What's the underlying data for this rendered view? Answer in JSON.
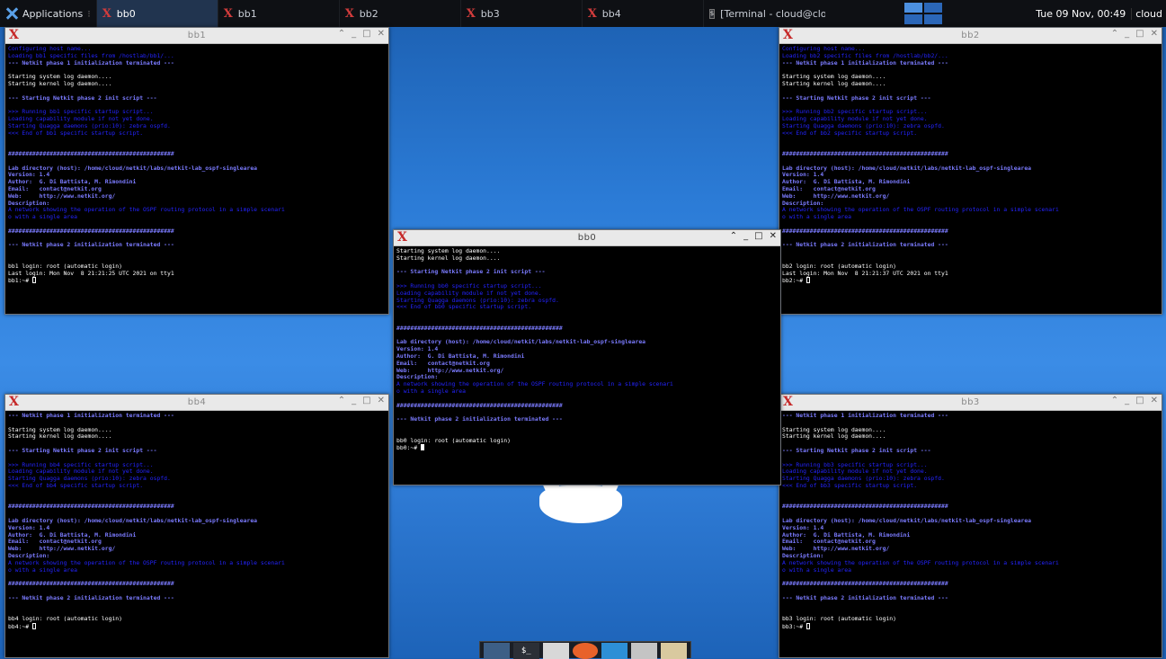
{
  "panel": {
    "apps_label": "Applications",
    "tasks": [
      {
        "label": "bb0",
        "active": true
      },
      {
        "label": "bb1"
      },
      {
        "label": "bb2"
      },
      {
        "label": "bb3"
      },
      {
        "label": "bb4"
      },
      {
        "label": "[Terminal - cloud@cloud..."
      }
    ],
    "clock": "Tue 09 Nov, 00:49",
    "user": "cloud"
  },
  "windows": {
    "bb1": {
      "title": "bb1",
      "lines": [
        {
          "t": "Configuring host name...",
          "c": "blue"
        },
        {
          "t": "Loading bb1 specific files from /hostlab/bb1/...",
          "c": "blue"
        },
        {
          "t": "--- Netkit phase 1 initialization terminated ---",
          "c": "hdr"
        },
        {
          "t": ""
        },
        {
          "t": "Starting system log daemon...."
        },
        {
          "t": "Starting kernel log daemon...."
        },
        {
          "t": ""
        },
        {
          "t": "--- Starting Netkit phase 2 init script ---",
          "c": "hdr"
        },
        {
          "t": ""
        },
        {
          "t": ">>> Running bb1 specific startup script...",
          "c": "blue"
        },
        {
          "t": "Loading capability module if not yet done.",
          "c": "blue"
        },
        {
          "t": "Starting Quagga daemons (prio:10): zebra ospfd.",
          "c": "blue"
        },
        {
          "t": "<<< End of bb1 specific startup script.",
          "c": "blue"
        },
        {
          "t": ""
        },
        {
          "t": ""
        },
        {
          "t": "################################################",
          "c": "hdr"
        },
        {
          "t": ""
        },
        {
          "t": "Lab directory (host): /home/cloud/netkit/labs/netkit-lab_ospf-singlearea",
          "c": "hdr"
        },
        {
          "t": "Version: 1.4",
          "c": "hdr"
        },
        {
          "t": "Author:  G. Di Battista, M. Rimondini",
          "c": "hdr"
        },
        {
          "t": "Email:   contact@netkit.org",
          "c": "hdr"
        },
        {
          "t": "Web:     http://www.netkit.org/",
          "c": "hdr"
        },
        {
          "t": "Description:",
          "c": "hdr"
        },
        {
          "t": "A network showing the operation of the OSPF routing protocol in a simple scenari",
          "c": "blue"
        },
        {
          "t": "o with a single area",
          "c": "blue"
        },
        {
          "t": ""
        },
        {
          "t": "################################################",
          "c": "hdr"
        },
        {
          "t": ""
        },
        {
          "t": "--- Netkit phase 2 initialization terminated ---",
          "c": "hdr"
        },
        {
          "t": ""
        },
        {
          "t": ""
        },
        {
          "t": "bb1 login: root (automatic login)"
        },
        {
          "t": "Last login: Mon Nov  8 21:21:25 UTC 2021 on tty1"
        },
        {
          "t": "bb1:~# ",
          "cursor": "hollow"
        }
      ]
    },
    "bb2": {
      "title": "bb2",
      "lines": [
        {
          "t": "Configuring host name...",
          "c": "blue"
        },
        {
          "t": "Loading bb2 specific files from /hostlab/bb2/...",
          "c": "blue"
        },
        {
          "t": "--- Netkit phase 1 initialization terminated ---",
          "c": "hdr"
        },
        {
          "t": ""
        },
        {
          "t": "Starting system log daemon...."
        },
        {
          "t": "Starting kernel log daemon...."
        },
        {
          "t": ""
        },
        {
          "t": "--- Starting Netkit phase 2 init script ---",
          "c": "hdr"
        },
        {
          "t": ""
        },
        {
          "t": ">>> Running bb2 specific startup script...",
          "c": "blue"
        },
        {
          "t": "Loading capability module if not yet done.",
          "c": "blue"
        },
        {
          "t": "Starting Quagga daemons (prio:10): zebra ospfd.",
          "c": "blue"
        },
        {
          "t": "<<< End of bb2 specific startup script.",
          "c": "blue"
        },
        {
          "t": ""
        },
        {
          "t": ""
        },
        {
          "t": "################################################",
          "c": "hdr"
        },
        {
          "t": ""
        },
        {
          "t": "Lab directory (host): /home/cloud/netkit/labs/netkit-lab_ospf-singlearea",
          "c": "hdr"
        },
        {
          "t": "Version: 1.4",
          "c": "hdr"
        },
        {
          "t": "Author:  G. Di Battista, M. Rimondini",
          "c": "hdr"
        },
        {
          "t": "Email:   contact@netkit.org",
          "c": "hdr"
        },
        {
          "t": "Web:     http://www.netkit.org/",
          "c": "hdr"
        },
        {
          "t": "Description:",
          "c": "hdr"
        },
        {
          "t": "A network showing the operation of the OSPF routing protocol in a simple scenari",
          "c": "blue"
        },
        {
          "t": "o with a single area",
          "c": "blue"
        },
        {
          "t": ""
        },
        {
          "t": "################################################",
          "c": "hdr"
        },
        {
          "t": ""
        },
        {
          "t": "--- Netkit phase 2 initialization terminated ---",
          "c": "hdr"
        },
        {
          "t": ""
        },
        {
          "t": ""
        },
        {
          "t": "bb2 login: root (automatic login)"
        },
        {
          "t": "Last login: Mon Nov  8 21:21:37 UTC 2021 on tty1"
        },
        {
          "t": "bb2:~# ",
          "cursor": "hollow"
        }
      ]
    },
    "bb0": {
      "title": "bb0",
      "lines": [
        {
          "t": "Starting system log daemon...."
        },
        {
          "t": "Starting kernel log daemon...."
        },
        {
          "t": ""
        },
        {
          "t": "--- Starting Netkit phase 2 init script ---",
          "c": "hdr"
        },
        {
          "t": ""
        },
        {
          "t": ">>> Running bb0 specific startup script...",
          "c": "blue"
        },
        {
          "t": "Loading capability module if not yet done.",
          "c": "blue"
        },
        {
          "t": "Starting Quagga daemons (prio:10): zebra ospfd.",
          "c": "blue"
        },
        {
          "t": "<<< End of bb0 specific startup script.",
          "c": "blue"
        },
        {
          "t": ""
        },
        {
          "t": ""
        },
        {
          "t": "################################################",
          "c": "hdr"
        },
        {
          "t": ""
        },
        {
          "t": "Lab directory (host): /home/cloud/netkit/labs/netkit-lab_ospf-singlearea",
          "c": "hdr"
        },
        {
          "t": "Version: 1.4",
          "c": "hdr"
        },
        {
          "t": "Author:  G. Di Battista, M. Rimondini",
          "c": "hdr"
        },
        {
          "t": "Email:   contact@netkit.org",
          "c": "hdr"
        },
        {
          "t": "Web:     http://www.netkit.org/",
          "c": "hdr"
        },
        {
          "t": "Description:",
          "c": "hdr"
        },
        {
          "t": "A network showing the operation of the OSPF routing protocol in a simple scenari",
          "c": "blue"
        },
        {
          "t": "o with a single area",
          "c": "blue"
        },
        {
          "t": ""
        },
        {
          "t": "################################################",
          "c": "hdr"
        },
        {
          "t": ""
        },
        {
          "t": "--- Netkit phase 2 initialization terminated ---",
          "c": "hdr"
        },
        {
          "t": ""
        },
        {
          "t": ""
        },
        {
          "t": "bb0 login: root (automatic login)"
        },
        {
          "t": "bb0:~# ",
          "cursor": "solid"
        }
      ]
    },
    "bb4": {
      "title": "bb4",
      "lines": [
        {
          "t": "--- Netkit phase 1 initialization terminated ---",
          "c": "hdr"
        },
        {
          "t": ""
        },
        {
          "t": "Starting system log daemon...."
        },
        {
          "t": "Starting kernel log daemon...."
        },
        {
          "t": ""
        },
        {
          "t": "--- Starting Netkit phase 2 init script ---",
          "c": "hdr"
        },
        {
          "t": ""
        },
        {
          "t": ">>> Running bb4 specific startup script...",
          "c": "blue"
        },
        {
          "t": "Loading capability module if not yet done.",
          "c": "blue"
        },
        {
          "t": "Starting Quagga daemons (prio:10): zebra ospfd.",
          "c": "blue"
        },
        {
          "t": "<<< End of bb4 specific startup script.",
          "c": "blue"
        },
        {
          "t": ""
        },
        {
          "t": ""
        },
        {
          "t": "################################################",
          "c": "hdr"
        },
        {
          "t": ""
        },
        {
          "t": "Lab directory (host): /home/cloud/netkit/labs/netkit-lab_ospf-singlearea",
          "c": "hdr"
        },
        {
          "t": "Version: 1.4",
          "c": "hdr"
        },
        {
          "t": "Author:  G. Di Battista, M. Rimondini",
          "c": "hdr"
        },
        {
          "t": "Email:   contact@netkit.org",
          "c": "hdr"
        },
        {
          "t": "Web:     http://www.netkit.org/",
          "c": "hdr"
        },
        {
          "t": "Description:",
          "c": "hdr"
        },
        {
          "t": "A network showing the operation of the OSPF routing protocol in a simple scenari",
          "c": "blue"
        },
        {
          "t": "o with a single area",
          "c": "blue"
        },
        {
          "t": ""
        },
        {
          "t": "################################################",
          "c": "hdr"
        },
        {
          "t": ""
        },
        {
          "t": "--- Netkit phase 2 initialization terminated ---",
          "c": "hdr"
        },
        {
          "t": ""
        },
        {
          "t": ""
        },
        {
          "t": "bb4 login: root (automatic login)"
        },
        {
          "t": "bb4:~# ",
          "cursor": "hollow"
        }
      ]
    },
    "bb3": {
      "title": "bb3",
      "lines": [
        {
          "t": "--- Netkit phase 1 initialization terminated ---",
          "c": "hdr"
        },
        {
          "t": ""
        },
        {
          "t": "Starting system log daemon...."
        },
        {
          "t": "Starting kernel log daemon...."
        },
        {
          "t": ""
        },
        {
          "t": "--- Starting Netkit phase 2 init script ---",
          "c": "hdr"
        },
        {
          "t": ""
        },
        {
          "t": ">>> Running bb3 specific startup script...",
          "c": "blue"
        },
        {
          "t": "Loading capability module if not yet done.",
          "c": "blue"
        },
        {
          "t": "Starting Quagga daemons (prio:10): zebra ospfd.",
          "c": "blue"
        },
        {
          "t": "<<< End of bb3 specific startup script.",
          "c": "blue"
        },
        {
          "t": ""
        },
        {
          "t": ""
        },
        {
          "t": "################################################",
          "c": "hdr"
        },
        {
          "t": ""
        },
        {
          "t": "Lab directory (host): /home/cloud/netkit/labs/netkit-lab_ospf-singlearea",
          "c": "hdr"
        },
        {
          "t": "Version: 1.4",
          "c": "hdr"
        },
        {
          "t": "Author:  G. Di Battista, M. Rimondini",
          "c": "hdr"
        },
        {
          "t": "Email:   contact@netkit.org",
          "c": "hdr"
        },
        {
          "t": "Web:     http://www.netkit.org/",
          "c": "hdr"
        },
        {
          "t": "Description:",
          "c": "hdr"
        },
        {
          "t": "A network showing the operation of the OSPF routing protocol in a simple scenari",
          "c": "blue"
        },
        {
          "t": "o with a single area",
          "c": "blue"
        },
        {
          "t": ""
        },
        {
          "t": "################################################",
          "c": "hdr"
        },
        {
          "t": ""
        },
        {
          "t": "--- Netkit phase 2 initialization terminated ---",
          "c": "hdr"
        },
        {
          "t": ""
        },
        {
          "t": ""
        },
        {
          "t": "bb3 login: root (automatic login)"
        },
        {
          "t": "bb3:~# ",
          "cursor": "hollow"
        }
      ]
    }
  },
  "window_controls": {
    "minimize": "⌃",
    "iconify": "_",
    "maximize": "□",
    "close": "✕"
  },
  "dock": [
    {
      "icon": "show-desktop-icon",
      "color": "#3d5f86"
    },
    {
      "icon": "terminal-icon",
      "color": "#2b2f36",
      "label": "$_"
    },
    {
      "icon": "file-manager-icon",
      "color": "#d8d8d8"
    },
    {
      "icon": "firefox-icon",
      "color": "#e8622a"
    },
    {
      "icon": "graph-app-icon",
      "color": "#2d8fd6"
    },
    {
      "icon": "search-icon",
      "color": "#c4c4c4"
    },
    {
      "icon": "folder-icon",
      "color": "#d9c99f"
    }
  ],
  "colors": {
    "panel": "#0e1014",
    "terminal_bg": "#000000",
    "terminal_blue": "#2424ff",
    "desktop": "#2b7bd6"
  }
}
